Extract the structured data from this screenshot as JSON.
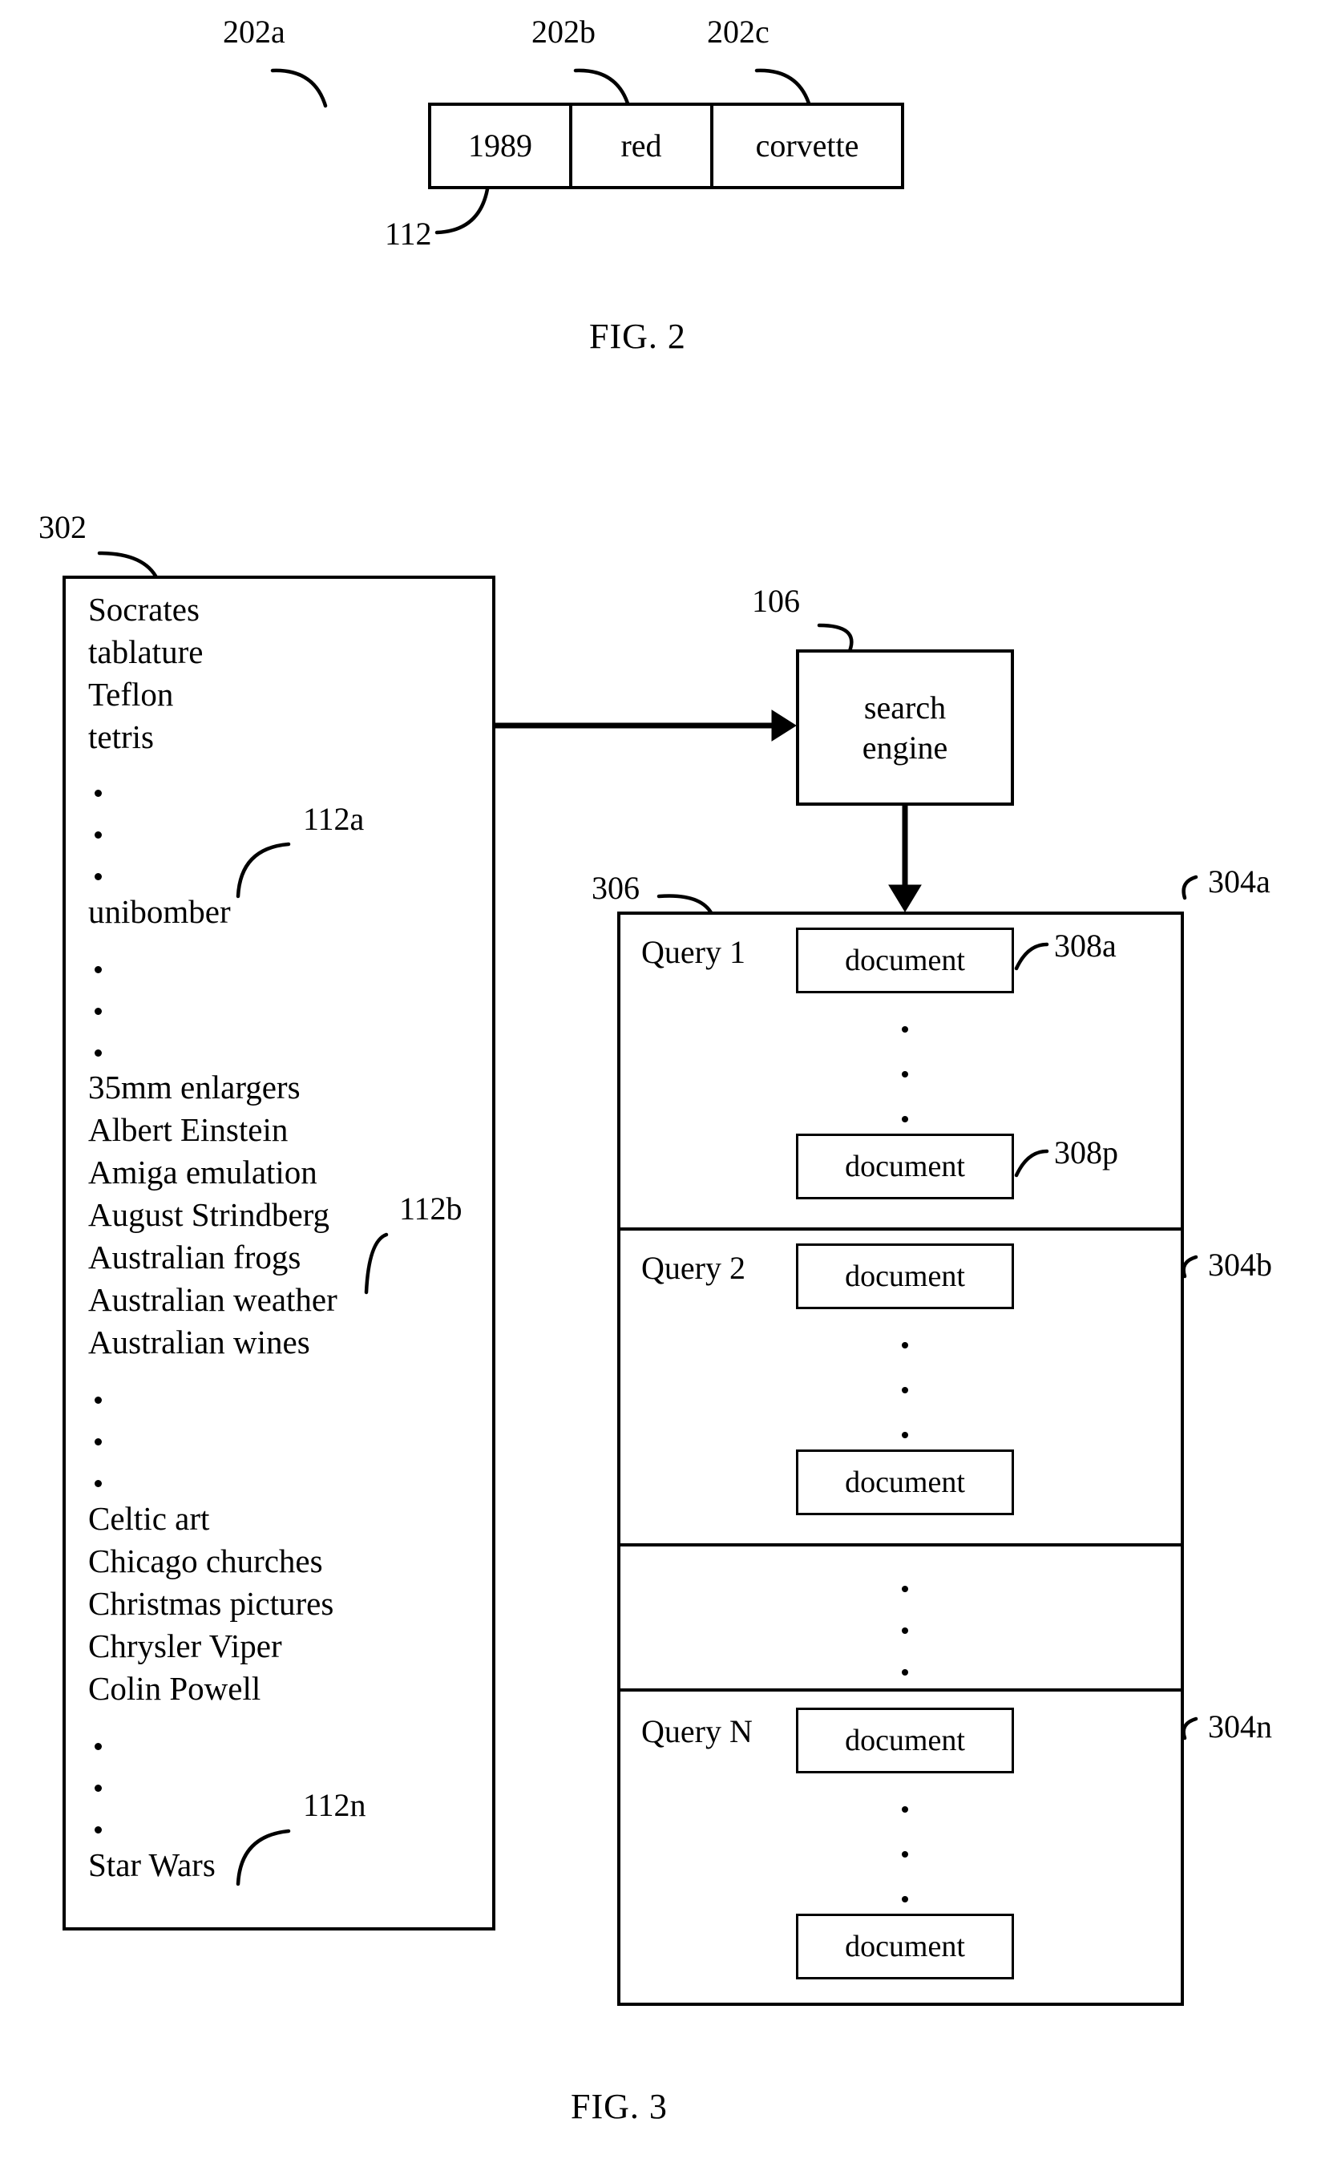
{
  "figure2": {
    "caption": "FIG. 2",
    "record_ref": "112",
    "fields": [
      {
        "ref": "202a",
        "value": "1989"
      },
      {
        "ref": "202b",
        "value": "red"
      },
      {
        "ref": "202c",
        "value": "corvette"
      }
    ]
  },
  "figure3": {
    "caption": "FIG. 3",
    "term_list": {
      "ref": "302",
      "group_refs": {
        "first": "112a",
        "second": "112b",
        "last": "112n"
      },
      "lines": [
        {
          "type": "term",
          "text": "Socrates"
        },
        {
          "type": "term",
          "text": "tablature"
        },
        {
          "type": "term",
          "text": "Teflon"
        },
        {
          "type": "term",
          "text": "tetris"
        },
        {
          "type": "dot"
        },
        {
          "type": "dot"
        },
        {
          "type": "dot"
        },
        {
          "type": "term",
          "text": "unibomber"
        },
        {
          "type": "dot"
        },
        {
          "type": "dot"
        },
        {
          "type": "dot"
        },
        {
          "type": "term",
          "text": "35mm enlargers"
        },
        {
          "type": "term",
          "text": "Albert Einstein"
        },
        {
          "type": "term",
          "text": "Amiga emulation"
        },
        {
          "type": "term",
          "text": "August Strindberg"
        },
        {
          "type": "term",
          "text": "Australian frogs"
        },
        {
          "type": "term",
          "text": "Australian weather"
        },
        {
          "type": "term",
          "text": "Australian wines"
        },
        {
          "type": "dot"
        },
        {
          "type": "dot"
        },
        {
          "type": "dot"
        },
        {
          "type": "term",
          "text": "Celtic art"
        },
        {
          "type": "term",
          "text": "Chicago churches"
        },
        {
          "type": "term",
          "text": "Christmas pictures"
        },
        {
          "type": "term",
          "text": "Chrysler Viper"
        },
        {
          "type": "term",
          "text": "Colin Powell"
        },
        {
          "type": "dot"
        },
        {
          "type": "dot"
        },
        {
          "type": "dot"
        },
        {
          "type": "term",
          "text": "Star Wars"
        }
      ]
    },
    "search_engine": {
      "ref": "106",
      "label": "search\nengine"
    },
    "results": {
      "ref": "306",
      "sections": [
        {
          "ref": "304a",
          "query_label": "Query 1",
          "first_doc": {
            "ref": "308a",
            "label": "document"
          },
          "last_doc": {
            "ref": "308p",
            "label": "document"
          }
        },
        {
          "ref": "304b",
          "query_label": "Query 2",
          "first_doc": {
            "label": "document"
          },
          "last_doc": {
            "label": "document"
          }
        },
        {
          "ref": "",
          "query_label": "",
          "ellipsis_only": true
        },
        {
          "ref": "304n",
          "query_label": "Query N",
          "first_doc": {
            "label": "document"
          },
          "last_doc": {
            "label": "document"
          }
        }
      ]
    }
  }
}
